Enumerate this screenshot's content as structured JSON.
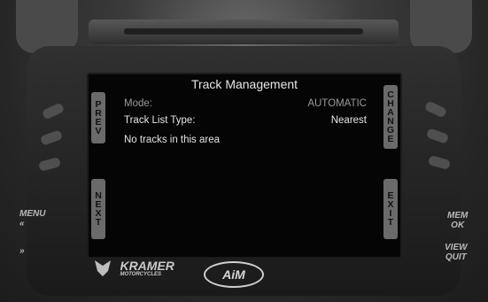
{
  "screen": {
    "title": "Track Management",
    "rows": [
      {
        "label": "Mode:",
        "value": "AUTOMATIC"
      },
      {
        "label": "Track List Type:",
        "value": "Nearest"
      }
    ],
    "message": "No tracks in this area"
  },
  "soft_buttons": {
    "prev": "P\nR\nE\nV",
    "change": "C\nH\nA\nN\nG\nE",
    "next": "N\nE\nX\nT",
    "exit": "E\nX\nI\nT"
  },
  "side_labels": {
    "menu": "MENU",
    "menu_arrow": "«",
    "forward_arrow": "»",
    "mem_ok": "MEM\nOK",
    "view_quit": "VIEW\nQUIT"
  },
  "branding": {
    "kramer": "KRAMER",
    "kramer_sub": "MOTORCYCLES",
    "aim": "AiM"
  },
  "colors": {
    "screen_bg": "#050505",
    "button_bg": "#6a6a6a",
    "text": "#e6e6e6"
  }
}
